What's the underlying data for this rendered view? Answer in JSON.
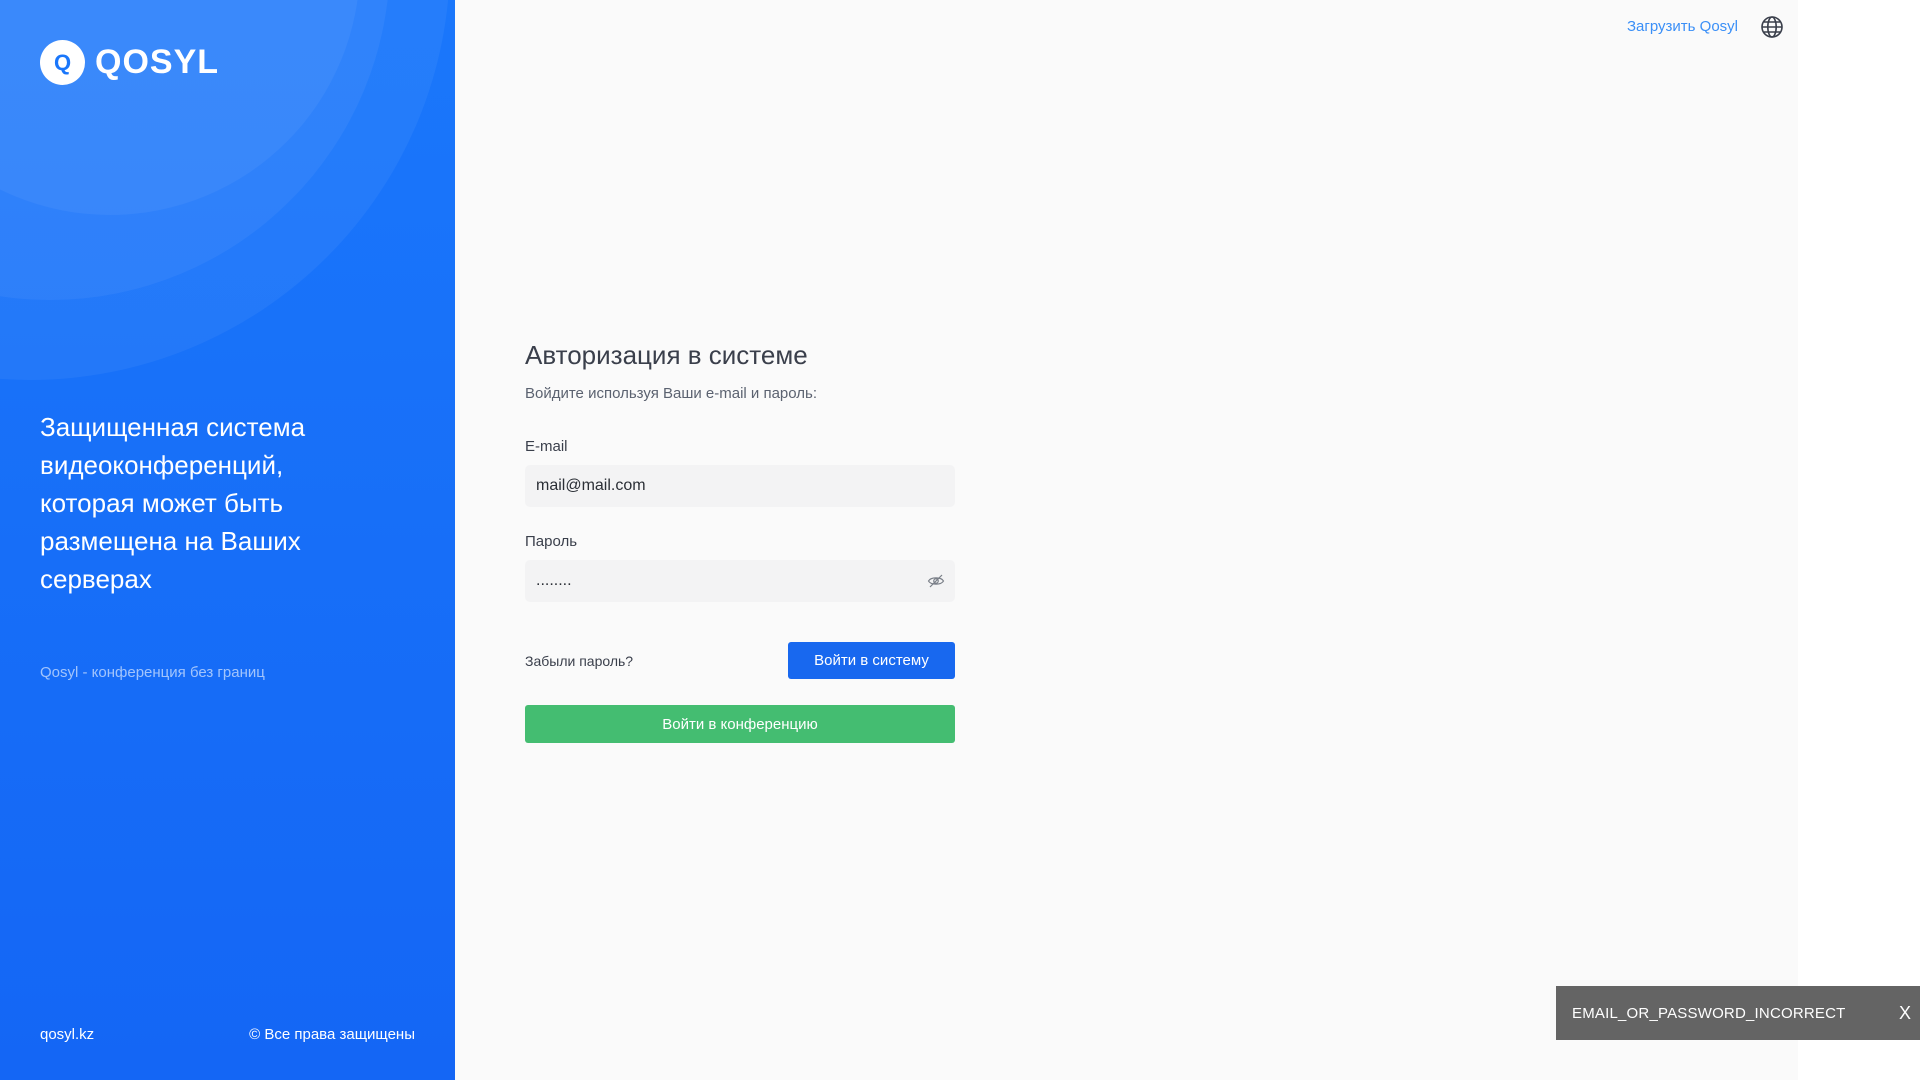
{
  "brand": {
    "logo_letter": "Q",
    "name": "QOSYL",
    "color": "#1a77fb"
  },
  "left_panel": {
    "tagline": "Защищенная система видеоконференций, которая может быть размещена на Ваших серверах",
    "slogan": "Qosyl - конференция без границ",
    "footer_site": "qosyl.kz",
    "footer_rights": "© Все права защищены"
  },
  "header": {
    "download_link": "Загрузить Qosyl",
    "language_icon": "globe-icon"
  },
  "login_form": {
    "title": "Авторизация в системе",
    "subtitle": "Войдите используя Ваши e-mail и пароль:",
    "email_label": "E-mail",
    "email_value": "mail@mail.com",
    "password_label": "Пароль",
    "password_value": "........",
    "password_toggle_icon": "eye-off-icon",
    "forgot_password": "Забыли пароль?",
    "login_button": "Войти в систему",
    "conference_button": "Войти в конференцию",
    "login_button_color": "#1868ef",
    "conference_button_color": "#44bd71"
  },
  "toast": {
    "message": "EMAIL_OR_PASSWORD_INCORRECT",
    "close_label": "X"
  }
}
